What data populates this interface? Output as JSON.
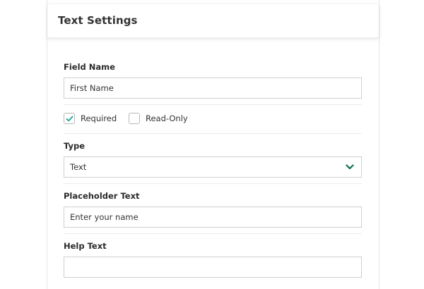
{
  "panel": {
    "title": "Text Settings"
  },
  "field_name": {
    "label": "Field Name",
    "value": "First Name"
  },
  "options": {
    "required": {
      "label": "Required",
      "checked": true
    },
    "read_only": {
      "label": "Read-Only",
      "checked": false
    }
  },
  "type": {
    "label": "Type",
    "selected": "Text"
  },
  "placeholder_text": {
    "label": "Placeholder Text",
    "value": "Enter your name"
  },
  "help_text": {
    "label": "Help Text",
    "value": ""
  },
  "colors": {
    "accent": "#1aa39a",
    "chevron": "#0f6b57",
    "border": "#cfcfcf"
  },
  "icons": {
    "check": "check-icon",
    "dropdown": "chevron-down-icon"
  }
}
